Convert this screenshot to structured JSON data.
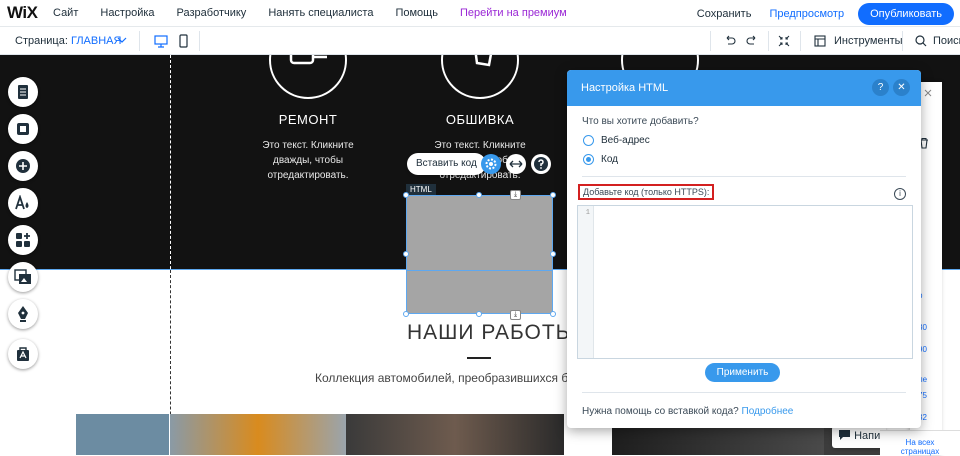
{
  "topbar": {
    "logo": "WiX",
    "menu": [
      "Сайт",
      "Настройка",
      "Разработчику",
      "Нанять специалиста",
      "Помощь",
      "Перейти на премиум"
    ],
    "save": "Сохранить",
    "preview": "Предпросмотр",
    "publish": "Опубликовать"
  },
  "toolbar": {
    "page_label": "Страница:",
    "page_name": "ГЛАВНАЯ",
    "tools": "Инструменты",
    "search": "Поиск"
  },
  "canvas": {
    "services": [
      {
        "title": "РЕМОНТ",
        "text": "Это текст. Кликните дважды, чтобы отредактировать."
      },
      {
        "title": "ОБШИВКА",
        "text": "Это текст. Кликните дважды, чтобы отредактировать."
      }
    ],
    "works_title": "НАШИ РАБОТЫ",
    "works_sub": "Коллекция автомобилей, преобразившихся б",
    "html_tag": "HTML",
    "insert_code": "Вставить код",
    "side_numbers": [
      "р",
      ")",
      "30",
      "90",
      "ле",
      "75",
      "32"
    ],
    "chat": "Напи",
    "all_pages": [
      "На всех",
      "страницах"
    ]
  },
  "dialog": {
    "title": "Настройка HTML",
    "question": "Что вы хотите добавить?",
    "options": [
      "Веб-адрес",
      "Код"
    ],
    "selected": "Код",
    "code_label": "Добавьте код (только HTTPS):",
    "line_number": "1",
    "apply": "Применить",
    "help_text": "Нужна помощь со вставкой кода?",
    "help_link": "Подробнее"
  },
  "colors": {
    "accent": "#116dff",
    "dialog_header": "#3899ec",
    "premium": "#9a27d5",
    "highlight": "#d32020"
  }
}
